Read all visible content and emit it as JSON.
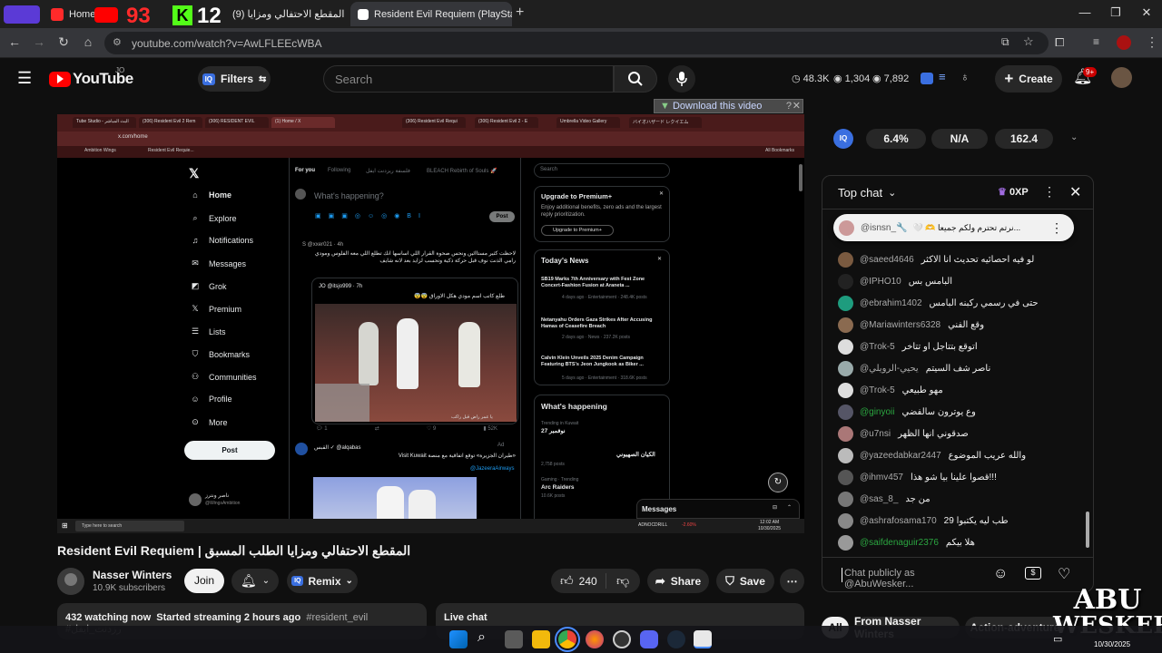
{
  "browser": {
    "tabs": [
      {
        "label": "Home / X"
      },
      {
        "label": "(9) المقطع الاحتفالي ومزايا"
      },
      {
        "label": "Resident Evil Requiem (PlayStat"
      }
    ],
    "overlay_numbers": [
      "93",
      "12"
    ],
    "url": "youtube.com/watch?v=AwLFLEEcWBA",
    "colors": {
      "tabstrip": "#1f1f1f",
      "toolbar": "#35363a"
    }
  },
  "youtube": {
    "logo": "YouTube",
    "logo_region": "JO",
    "filters_label": "Filters",
    "search_placeholder": "Search",
    "stats": [
      "48.3K",
      "1,304",
      "7,892"
    ],
    "create_label": "Create",
    "notif_count": "9+"
  },
  "download_bar": "Download this video",
  "video_content": {
    "tabs": [
      "Tube Studio - البث المباشر",
      "(306) Resident Evil 2 Rem",
      "(306) RESIDENT EVIL",
      "(1) Home / X",
      "(306) Resident Evil Requi",
      "(306) Resident Evil 2 - E",
      "Umbrella Video Gallery",
      "バイオハザード レクイエム"
    ],
    "address": "x.com/home",
    "bookmarks": [
      "Ambition Wings",
      "Resident Evil Requie..."
    ],
    "all_bookmarks": "All Bookmarks",
    "nav": [
      "Home",
      "Explore",
      "Notifications",
      "Messages",
      "Grok",
      "Premium",
      "Lists",
      "Bookmarks",
      "Communities",
      "Profile",
      "More"
    ],
    "post_btn": "Post",
    "feed_tabs": [
      "For you",
      "Following",
      "فلسفة ريزدنت ايفل",
      "BLEACH Rebirth of Souls 🚀"
    ],
    "whats_happening": "What's happening?",
    "post_small": "Post",
    "search": "Search",
    "premium": {
      "title": "Upgrade to Premium+",
      "text": "Enjoy additional benefits, zero ads and the largest reply prioritization.",
      "btn": "Upgrade to Premium+"
    },
    "todays_news": "Today's News",
    "news": [
      {
        "title": "SB19 Marks 7th Anniversary with Fest Zone Concert-Fashion Fusion at Araneta ...",
        "meta": "4 days ago · Entertainment · 248.4K posts"
      },
      {
        "title": "Netanyahu Orders Gaza Strikes After Accusing Hamas of Ceasefire Breach",
        "meta": "2 days ago · News · 237.2K posts"
      },
      {
        "title": "Calvin Klein Unveils 2025 Denim Campaign Featuring BTS's Jeon Jungkook as Biker ...",
        "meta": "5 days ago · Entertainment · 318.6K posts"
      }
    ],
    "whats_happening_title": "What's happening",
    "trends": [
      {
        "ctx": "Trending in Kuwait",
        "name": "نوفمبر 27"
      },
      {
        "ctx": "",
        "name": "الكيان الصهيوني"
      },
      {
        "ctx": "2,758 posts",
        "name": ""
      },
      {
        "ctx": "Gaming · Trending",
        "name": "Arc Raiders"
      },
      {
        "ctx": "10.6K posts",
        "name": ""
      }
    ],
    "tweet1_user": "S @xxer021 · 4h",
    "tweet1_text": "لاحظت كثير مستاائين ونحس صحوة القرار اللي اساسها انك تطلع اللي معه الفلوس ومودي رامي الذنت نوف قبل حركة ذكية وتحسب لزايد بعد لانه شايف",
    "quote_user": "JO @itsjo999 · 7h",
    "quote_text": "طلع كاتب اسم مودي هكل الاوراق 😨😨",
    "video_caption": "يا عمر راض قبل راكب",
    "tweet_actions": [
      "1",
      "",
      "9",
      "52K"
    ],
    "ad_user": "القبس ✓ @alqabas",
    "ad_label": "Ad",
    "ad_text": "«طيران الجزيرة» توقع اتفاقية مع منصة Visit Kuwait",
    "ad_handle": "@JazeeraAirways",
    "profile_name": "ناصر ونترز",
    "profile_handle": "@WingsAmbition",
    "messages": "Messages",
    "taskbar_search": "Type here to search",
    "stock": "ADNOCDRILL",
    "stock_change": "-2.60%",
    "clock": "12:02 AM",
    "date": "10/30/2025"
  },
  "video_info": {
    "title": "Resident Evil Requiem | المقطع الاحتفالي ومزايا الطلب المسبق",
    "channel": "Nasser Winters",
    "subscribers": "10.9K subscribers",
    "join": "Join",
    "remix": "Remix",
    "likes": "240",
    "share": "Share",
    "save": "Save",
    "watching": "432 watching now",
    "streaming": "Started streaming 2 hours ago",
    "hashtags": "#resident_evil #رزدنت_ايفل",
    "live_chat": "Live chat"
  },
  "iq_stats": [
    "6.4%",
    "N/A",
    "162.4"
  ],
  "chat": {
    "header": "Top chat",
    "xp": "0XP",
    "pinned_user": "@isnsn_🔧",
    "pinned_text": "🤍 🫶 نرتم تحترم ولكم جميعا...",
    "messages": [
      {
        "user": "@saeed4646",
        "text": "لو فيه احصائيه تحديث انا الاكثر",
        "color": "#7a5a40"
      },
      {
        "user": "@IPHO10",
        "text": "البامس بس",
        "color": "#222"
      },
      {
        "user": "@ebrahim1402",
        "text": "حتى في رسمي ركبنه البامس",
        "color": "#1e9c7e"
      },
      {
        "user": "@Mariawinters6328",
        "text": "وقع الفني",
        "color": "#8a6a50"
      },
      {
        "user": "@Trok-5",
        "text": "اتوقع بتتاجل او تتاخر",
        "color": "#ddd"
      },
      {
        "user": "@يحيي-الرويلي",
        "text": "ناصر شف السيتم",
        "color": "#9aa"
      },
      {
        "user": "@Trok-5",
        "text": "مهو طبيعي",
        "color": "#ddd"
      },
      {
        "user": "@ginyoii",
        "text": "وع يوترون سالفضي",
        "color": "#556",
        "green": true
      },
      {
        "user": "@u7nsi",
        "text": "صدقوني انها الظهر",
        "color": "#a77"
      },
      {
        "user": "@yazeedabkar2447",
        "text": "والله عريب الموضوع",
        "color": "#bbb"
      },
      {
        "user": "@ihmv457",
        "text": "قصوا علينا بيا شو هذا!!!",
        "color": "#555"
      },
      {
        "user": "@sas_8_",
        "text": "من جد",
        "color": "#777"
      },
      {
        "user": "@ashrafosama170",
        "text": "29 طب ليه يكتبوا",
        "color": "#888"
      },
      {
        "user": "@saifdenaguir2376",
        "text": "هلا بيكم",
        "color": "#999",
        "green": true
      }
    ],
    "input_placeholder": "Chat publicly as @AbuWesker..."
  },
  "bottom_chips": [
    "All",
    "From Nasser Winters",
    "Action-adventure"
  ],
  "watermark": [
    "ABU",
    "WESKER"
  ],
  "taskbar": {
    "date": "10/30/2025"
  }
}
